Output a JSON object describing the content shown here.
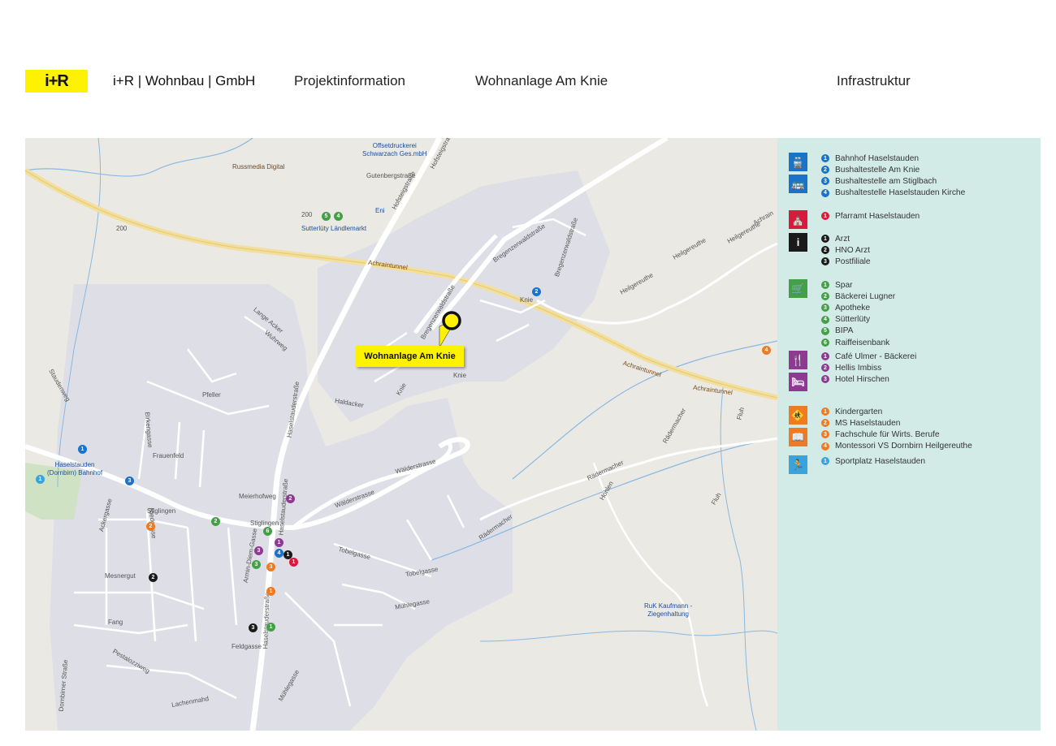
{
  "header": {
    "logo_text": "i+R",
    "company_name": "i+R | Wohnbau | GmbH",
    "section": "Projektinformation",
    "project": "Wohnanlage Am Knie",
    "page_title": "Infrastruktur"
  },
  "map": {
    "pin_label": "Wohnanlage Am Knie",
    "poi_labels": {
      "offsetdruck": "Offsetdruckerei\nSchwarzach Ges.mbH",
      "russmedia": "Russmedia Digital",
      "eni": "Eni",
      "suetterluety": "Sutterlüty Ländlemarkt",
      "bahnhof": "Haselstauden\n(Dornbirn) Bahnhof",
      "kaufmann": "RuK Kaufmann -\nZiegenhaltung"
    },
    "tunnel_labels": [
      "Achraintunnel",
      "Achraintunnel",
      "Achraintunnel"
    ],
    "road_labels": {
      "road200a": "200",
      "road200b": "200",
      "hofsteig1": "Hofsteigstraße",
      "hofsteig2": "Hofsteigstraße",
      "gutenberg": "Gutenbergstraße",
      "haselstauden1": "Haselstauderstraße",
      "haselstauden2": "Haselstauderstraße",
      "haselstauden3": "Haselstauderstraße",
      "bregenzer1": "Bregenzerwaldstraße",
      "bregenzer2": "Bregenzerwaldstraße",
      "bregenzer3": "Bregenzerwaldstraße",
      "knie1": "Knie",
      "knie2": "Knie",
      "knie3": "Knie",
      "heilgereuthe1": "Heilgereuthe",
      "heilgereuthe2": "Heilgereuthe",
      "heilgereuthe3": "Heilgereuthe",
      "achrain": "Achrain",
      "waelder1": "Wälderstrasse",
      "waelder2": "Wälderstrasse",
      "raedermacher1": "Rädermacher",
      "raedermacher2": "Rädermacher",
      "raedermacher3": "Rädermacher",
      "fluh1": "Fluh",
      "fluh2": "Fluh",
      "hohlen": "Hohlen",
      "stiglingen1": "Stiglingen",
      "stiglingen2": "Stiglingen",
      "frauenfeld": "Frauenfeld",
      "pfeller": "Pfeller",
      "meierhofweg": "Meierhofweg",
      "mesnergut": "Mesnergut",
      "fang": "Fang",
      "feldgasse": "Feldgasse",
      "muehlegasse1": "Mühlegasse",
      "muehlegasse2": "Mühlegasse",
      "tobelgasse1": "Tobelgasse",
      "tobelgasse2": "Tobelgasse",
      "staudenweg": "Staudenweg",
      "lange_acker": "Lange Acker",
      "wuhrweg": "Wuhrweg",
      "dornbirn": "Dornbirner Straße",
      "pestalozzi": "Pestalozziweg",
      "lachenmahd": "Lachenmahd",
      "haldacker": "Haldacker",
      "birkengasse": "Birkengasse",
      "armin_diem": "Armin-Diem-Gasse",
      "ackergasse": "Ackergasse",
      "riedgasse": "Riedgasse"
    },
    "markers": [
      {
        "n": "1",
        "color": "#1a73c8",
        "cat": "bahn"
      },
      {
        "n": "1",
        "color": "#3aa3dc",
        "cat": "sport"
      },
      {
        "n": "3",
        "color": "#1a73c8",
        "cat": "bus"
      },
      {
        "n": "2",
        "color": "#1a73c8",
        "cat": "bus"
      },
      {
        "n": "4",
        "color": "#1a73c8",
        "cat": "bus"
      },
      {
        "n": "5",
        "color": "#43a047",
        "cat": "shop"
      },
      {
        "n": "4",
        "color": "#43a047",
        "cat": "shop"
      },
      {
        "n": "2",
        "color": "#43a047",
        "cat": "shop"
      },
      {
        "n": "6",
        "color": "#43a047",
        "cat": "shop"
      },
      {
        "n": "3",
        "color": "#43a047",
        "cat": "shop"
      },
      {
        "n": "1",
        "color": "#43a047",
        "cat": "shop"
      },
      {
        "n": "2",
        "color": "#8e3a93",
        "cat": "gastro"
      },
      {
        "n": "1",
        "color": "#8e3a93",
        "cat": "gastro"
      },
      {
        "n": "3",
        "color": "#8e3a93",
        "cat": "gastro"
      },
      {
        "n": "1",
        "color": "#1a1a1a",
        "cat": "info"
      },
      {
        "n": "2",
        "color": "#1a1a1a",
        "cat": "info"
      },
      {
        "n": "3",
        "color": "#1a1a1a",
        "cat": "info"
      },
      {
        "n": "1",
        "color": "#d81b3c",
        "cat": "kirche"
      },
      {
        "n": "2",
        "color": "#ef7a22",
        "cat": "school"
      },
      {
        "n": "3",
        "color": "#ef7a22",
        "cat": "school"
      },
      {
        "n": "1",
        "color": "#ef7a22",
        "cat": "school"
      },
      {
        "n": "4",
        "color": "#ef7a22",
        "cat": "school"
      }
    ]
  },
  "legend": {
    "groups": [
      {
        "id": "transport",
        "icons": [
          "train-icon",
          "bus-icon"
        ],
        "colors": [
          "#1a73c8",
          "#1a73c8"
        ],
        "num_color": "#1a73c8",
        "items": [
          {
            "n": "1",
            "label": "Bahnhof Haselstauden"
          },
          {
            "n": "2",
            "label": "Bushaltestelle Am Knie"
          },
          {
            "n": "3",
            "label": "Bushaltestelle am Stiglbach"
          },
          {
            "n": "4",
            "label": "Bushaltestelle Haselstauden Kirche"
          }
        ]
      },
      {
        "id": "church",
        "icons": [
          "church-icon"
        ],
        "colors": [
          "#d81b3c"
        ],
        "num_color": "#d81b3c",
        "items": [
          {
            "n": "1",
            "label": "Pfarramt Haselstauden"
          }
        ]
      },
      {
        "id": "services",
        "icons": [
          "info-icon"
        ],
        "colors": [
          "#1a1a1a"
        ],
        "num_color": "#1a1a1a",
        "items": [
          {
            "n": "1",
            "label": "Arzt"
          },
          {
            "n": "2",
            "label": "HNO Arzt"
          },
          {
            "n": "3",
            "label": "Postfiliale"
          }
        ]
      },
      {
        "id": "shopping",
        "icons": [
          "cart-icon"
        ],
        "colors": [
          "#43a047"
        ],
        "num_color": "#43a047",
        "items": [
          {
            "n": "1",
            "label": "Spar"
          },
          {
            "n": "2",
            "label": "Bäckerei Lugner"
          },
          {
            "n": "3",
            "label": "Apotheke"
          },
          {
            "n": "4",
            "label": "Sütterlüty"
          },
          {
            "n": "5",
            "label": "BIPA"
          },
          {
            "n": "6",
            "label": "Raiffeisenbank"
          }
        ]
      },
      {
        "id": "gastro",
        "icons": [
          "restaurant-icon",
          "hotel-icon"
        ],
        "colors": [
          "#8e3a93",
          "#8e3a93"
        ],
        "num_color": "#8e3a93",
        "items": [
          {
            "n": "1",
            "label": "Café Ulmer - Bäckerei"
          },
          {
            "n": "2",
            "label": "Hellis Imbiss"
          },
          {
            "n": "3",
            "label": "Hotel Hirschen"
          }
        ]
      },
      {
        "id": "education",
        "icons": [
          "school-icon",
          "book-icon"
        ],
        "colors": [
          "#ef7a22",
          "#ef7a22"
        ],
        "num_color": "#ef7a22",
        "items": [
          {
            "n": "1",
            "label": "Kindergarten"
          },
          {
            "n": "2",
            "label": "MS Haselstauden"
          },
          {
            "n": "3",
            "label": "Fachschule für Wirts. Berufe"
          },
          {
            "n": "4",
            "label": "Montessori VS Dornbirn Heilgereuthe"
          }
        ]
      },
      {
        "id": "sport",
        "icons": [
          "sport-icon"
        ],
        "colors": [
          "#3aa3dc"
        ],
        "num_color": "#3aa3dc",
        "items": [
          {
            "n": "1",
            "label": "Sportplatz Haselstauden"
          }
        ]
      }
    ]
  }
}
